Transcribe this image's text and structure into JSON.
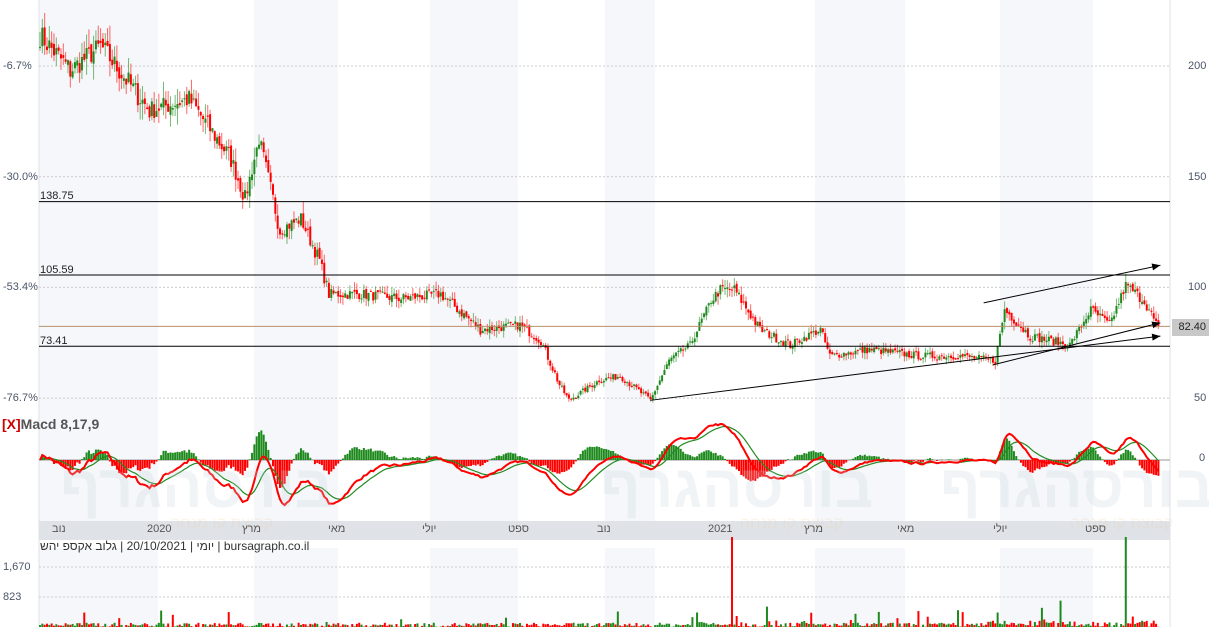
{
  "chart_data": {
    "type": "candlestick",
    "price_axis": {
      "ticks": [
        50,
        100,
        150,
        200
      ],
      "range": [
        38,
        236
      ]
    },
    "percent_axis": {
      "ticks": [
        "-6.7%",
        "-30.0%",
        "-53.4%",
        "-76.7%"
      ]
    },
    "horizontal_levels": [
      138.75,
      105.59,
      73.41
    ],
    "horizontal_level_labels": [
      "138.75",
      "105.59",
      "73.41"
    ],
    "last_price": 82.4,
    "last_price_label": "82.40",
    "price_path_day_close": [
      [
        0,
        214
      ],
      [
        13,
        198
      ],
      [
        26,
        209
      ],
      [
        47,
        180
      ],
      [
        64,
        185
      ],
      [
        82,
        158
      ],
      [
        88,
        140
      ],
      [
        94,
        167
      ],
      [
        103,
        126
      ],
      [
        112,
        131
      ],
      [
        120,
        112
      ],
      [
        124,
        97
      ],
      [
        137,
        97
      ],
      [
        155,
        95
      ],
      [
        172,
        97
      ],
      [
        189,
        81
      ],
      [
        206,
        83
      ],
      [
        215,
        76
      ],
      [
        223,
        56
      ],
      [
        227,
        49
      ],
      [
        240,
        58
      ],
      [
        249,
        60
      ],
      [
        262,
        49
      ],
      [
        270,
        67
      ],
      [
        279,
        74
      ],
      [
        288,
        94
      ],
      [
        292,
        99
      ],
      [
        298,
        99
      ],
      [
        309,
        81
      ],
      [
        322,
        74
      ],
      [
        335,
        81
      ],
      [
        339,
        69
      ],
      [
        356,
        72
      ],
      [
        378,
        69
      ],
      [
        395,
        69
      ],
      [
        410,
        67
      ],
      [
        414,
        90
      ],
      [
        425,
        78
      ],
      [
        442,
        74
      ],
      [
        451,
        90
      ],
      [
        459,
        83
      ],
      [
        466,
        101
      ],
      [
        474,
        94
      ],
      [
        480,
        81
      ]
    ],
    "trendlines": [
      {
        "from": [
          262,
          49
        ],
        "to": [
          480,
          78
        ]
      },
      {
        "from": [
          405,
          93
        ],
        "to": [
          480,
          110
        ]
      },
      {
        "from": [
          409,
          65
        ],
        "to": [
          480,
          84
        ]
      }
    ],
    "macd": {
      "title": "Macd 8,17,9",
      "close_label": "[X]",
      "params": [
        8,
        17,
        9
      ],
      "zero_label": "0"
    },
    "x_axis_labels": [
      "נוב",
      "2020",
      "מרץ",
      "מאי",
      "יולי",
      "ספט",
      "נוב",
      "2021",
      "מרץ",
      "מאי",
      "יולי",
      "ספט"
    ],
    "volume_axis": {
      "ticks": [
        "1,670",
        "823"
      ]
    },
    "volume_spikes": [
      [
        297,
        1670
      ],
      [
        466,
        1670
      ]
    ]
  },
  "footer": "יומי | 20/10/2021 | גלוב אקספ יהש | bursagraph.co.il",
  "watermark": {
    "brand": "בורסהגרף",
    "tagline": "קבוצת קו מנחה"
  },
  "colors": {
    "up": "#1e8a1e",
    "down": "#ff0000",
    "macd": "#ff0000",
    "signal": "#228b22",
    "band": "#f5f7fa"
  }
}
